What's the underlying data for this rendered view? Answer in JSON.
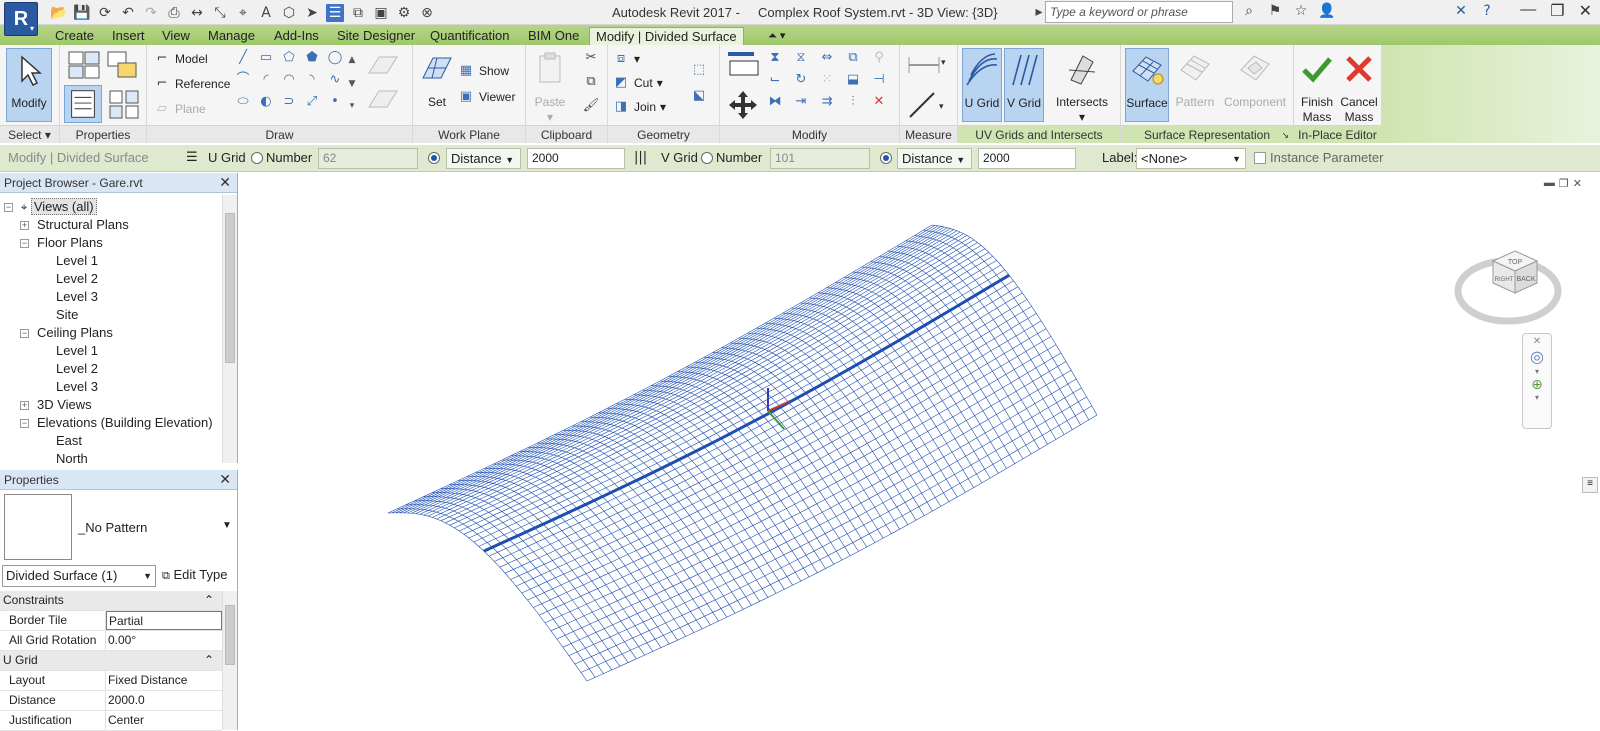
{
  "app": {
    "logo_letter": "R",
    "title": "Autodesk Revit 2017 -     Complex Roof System.rvt - 3D View: {3D}",
    "search_placeholder": "Type a keyword or phrase"
  },
  "tabs": [
    "Create",
    "Insert",
    "View",
    "Manage",
    "Add-Ins",
    "Site Designer",
    "Quantification",
    "BIM One",
    "Modify | Divided Surface"
  ],
  "ribbon": {
    "select": {
      "modify_label": "Modify",
      "panel_label": "Select"
    },
    "properties_panel_label": "Properties",
    "draw": {
      "model": "Model",
      "reference": "Reference",
      "plane": "Plane",
      "panel_label": "Draw"
    },
    "work_plane": {
      "set": "Set",
      "show": "Show",
      "viewer": "Viewer",
      "panel_label": "Work Plane"
    },
    "clipboard": {
      "paste": "Paste",
      "panel_label": "Clipboard"
    },
    "geometry": {
      "cut": "Cut",
      "join": "Join",
      "panel_label": "Geometry"
    },
    "modify_panel_label": "Modify",
    "measure_panel_label": "Measure",
    "uv": {
      "u_grid": "U Grid",
      "v_grid": "V Grid",
      "intersects": "Intersects",
      "panel_label": "UV Grids and Intersects"
    },
    "surface_rep": {
      "surface": "Surface",
      "pattern": "Pattern",
      "component": "Component",
      "panel_label": "Surface Representation"
    },
    "in_place": {
      "finish": "Finish Mass",
      "finish_l1": "Finish",
      "finish_l2": "Mass",
      "cancel_l1": "Cancel",
      "cancel_l2": "Mass",
      "panel_label": "In-Place Editor"
    }
  },
  "options_bar": {
    "context": "Modify | Divided Surface",
    "u_grid_label": "U Grid",
    "u_number_label": "Number",
    "u_number_value": "62",
    "u_mode": "Distance",
    "u_distance": "2000",
    "v_grid_label": "V Grid",
    "v_number_label": "Number",
    "v_number_value": "101",
    "v_mode": "Distance",
    "v_distance": "2000",
    "label_label": "Label:",
    "label_value": "<None>",
    "instance_param": "Instance Parameter"
  },
  "project_browser": {
    "title": "Project Browser - Gare.rvt",
    "nodes": [
      "Views (all)",
      "Structural Plans",
      "Floor Plans",
      "Level 1",
      "Level 2",
      "Level 3",
      "Site",
      "Ceiling Plans",
      "Level 1",
      "Level 2",
      "Level 3",
      "3D Views",
      "Elevations (Building Elevation)",
      "East",
      "North"
    ]
  },
  "properties": {
    "title": "Properties",
    "type_name": "_No Pattern",
    "instance_selector": "Divided Surface (1)",
    "edit_type": "Edit Type",
    "groups": [
      {
        "name": "Constraints",
        "rows": [
          {
            "k": "Border Tile",
            "v": "Partial"
          },
          {
            "k": "All Grid Rotation",
            "v": "0.00°"
          }
        ]
      },
      {
        "name": "U Grid",
        "rows": [
          {
            "k": "Layout",
            "v": "Fixed Distance"
          },
          {
            "k": "Distance",
            "v": "2000.0"
          },
          {
            "k": "Justification",
            "v": "Center"
          }
        ]
      }
    ]
  },
  "viewcube": {
    "top": "TOP",
    "back": "BACK",
    "right": "RIGHT"
  },
  "colors": {
    "mesh": "#1d4fb3",
    "ribbon_tab": "#a9cf79",
    "options_bar": "#dfe9cf"
  }
}
